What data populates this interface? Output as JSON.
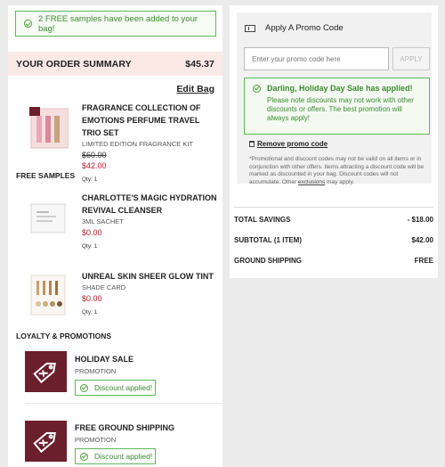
{
  "notice": {
    "text": "2 FREE samples have been added to your bag!"
  },
  "summary": {
    "title": "YOUR ORDER SUMMARY",
    "total": "$45.37",
    "edit_label": "Edit Bag"
  },
  "items": [
    {
      "name": "FRAGRANCE COLLECTION OF EMOTIONS PERFUME TRAVEL TRIO SET",
      "subtitle": "LIMITED EDITION FRAGRANCE KIT",
      "old_price": "$60.00",
      "price": "$42.00",
      "qty": "Qty: 1"
    }
  ],
  "free_samples_title": "FREE SAMPLES",
  "samples": [
    {
      "name": "CHARLOTTE'S MAGIC HYDRATION REVIVAL CLEANSER",
      "subtitle": "3ML SACHET",
      "price": "$0.00",
      "qty": "Qty: 1"
    },
    {
      "name": "UNREAL SKIN SHEER GLOW TINT",
      "subtitle": "SHADE CARD",
      "price": "$0.00",
      "qty": "Qty: 1"
    }
  ],
  "loyalty_title": "LOYALTY & PROMOTIONS",
  "promotions": [
    {
      "name": "HOLIDAY SALE",
      "type": "PROMOTION",
      "status": "Discount applied!"
    },
    {
      "name": "FREE GROUND SHIPPING",
      "type": "PROMOTION",
      "status": "Discount applied!"
    }
  ],
  "promo_code": {
    "title": "Apply A Promo Code",
    "placeholder": "Enter your promo code here",
    "apply_label": "APPLY",
    "sale_title": "Darling, Holiday Day Sale has applied!",
    "sale_note": "Please note discounts may not work with other discounts or offers. The best promotion will always apply!",
    "remove_label": "Remove promo code",
    "disclaimer": "*Promotional and discount codes may not be valid on all items or in conjunction with other offers. Items attracting a discount code will be marked as discounted in your bag. Discount codes will not accumulate. Other ",
    "exclusions_label": "exclusions",
    "disclaimer_end": " may apply."
  },
  "totals": [
    {
      "label": "TOTAL SAVINGS",
      "value": "- $18.00"
    },
    {
      "label": "SUBTOTAL (1 ITEM)",
      "value": "$42.00"
    },
    {
      "label": "GROUND SHIPPING",
      "value": "FREE"
    }
  ],
  "colors": {
    "accent_red": "#b01e2e",
    "success_green": "#3b8b2e",
    "summary_bg": "#fbe9e5",
    "promo_tile": "#6b1e2b"
  }
}
